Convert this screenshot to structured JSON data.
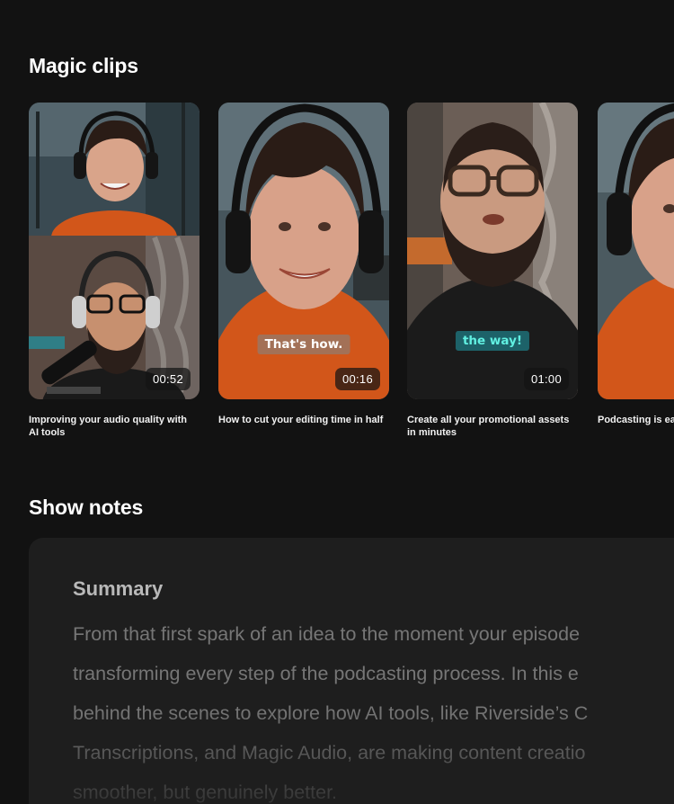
{
  "sections": {
    "magic_clips_title": "Magic clips",
    "show_notes_title": "Show notes"
  },
  "clips": [
    {
      "title": "Improving your audio quality with AI tools",
      "duration": "00:52",
      "caption": ""
    },
    {
      "title": "How to cut your editing time in half",
      "duration": "00:16",
      "caption": "That's how."
    },
    {
      "title": "Create all your promotional assets in minutes",
      "duration": "01:00",
      "caption": "the way!"
    },
    {
      "title": "Podcasting is ea accessible now",
      "duration": "",
      "caption": ""
    }
  ],
  "show_notes": {
    "heading": "Summary",
    "lines": [
      "From that first spark of an idea to the moment your episode",
      "transforming every step of the podcasting process. In this e",
      "behind the scenes to explore how AI tools, like Riverside’s C",
      "Transcriptions, and Magic Audio, are making content creatio",
      "smoother, but genuinely better."
    ]
  },
  "colors": {
    "background": "#121212",
    "card": "#1e1e1e",
    "shirt_orange": "#d2561a",
    "caption_teal": "#61f0e2"
  }
}
